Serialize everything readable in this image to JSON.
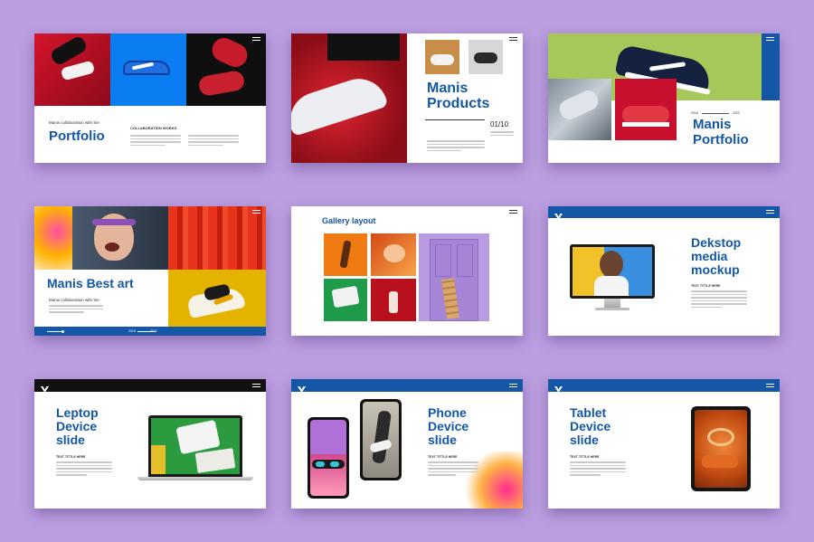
{
  "colors": {
    "background": "#ba9ee0",
    "brand_blue": "#1357a6",
    "red": "#c8102e",
    "lime": "#a6c85a",
    "yellow": "#e4b300"
  },
  "slides": [
    {
      "title": "Portfolio",
      "subtitle": "Manis collaboration with Sie",
      "heading2": "COLLABORATION WORKS"
    },
    {
      "title_l1": "Manis",
      "title_l2": "Products",
      "number": "01/10"
    },
    {
      "title_l1": "Manis",
      "title_l2": "Portfolio",
      "year_l": "2018",
      "year_r": "2022"
    },
    {
      "title": "Manis Best art",
      "subtitle": "Manis collaboration with Sie",
      "year_l": "2018",
      "year_r": "2022"
    },
    {
      "title": "Gallery layout"
    },
    {
      "title_l1": "Dekstop",
      "title_l2": "media",
      "title_l3": "mockup",
      "label": "TEXT TITTLE HERE"
    },
    {
      "title_l1": "Leptop",
      "title_l2": "Device",
      "title_l3": "slide",
      "label": "TEXT TITTLE HERE"
    },
    {
      "title_l1": "Phone",
      "title_l2": "Device",
      "title_l3": "slide",
      "label": "TEXT TITTLE HERE"
    },
    {
      "title_l1": "Tablet",
      "title_l2": "Device",
      "title_l3": "slide",
      "label": "TEXT TITTLE HERE"
    }
  ],
  "icons": [
    "brand-logo-icon",
    "menu-icon"
  ]
}
